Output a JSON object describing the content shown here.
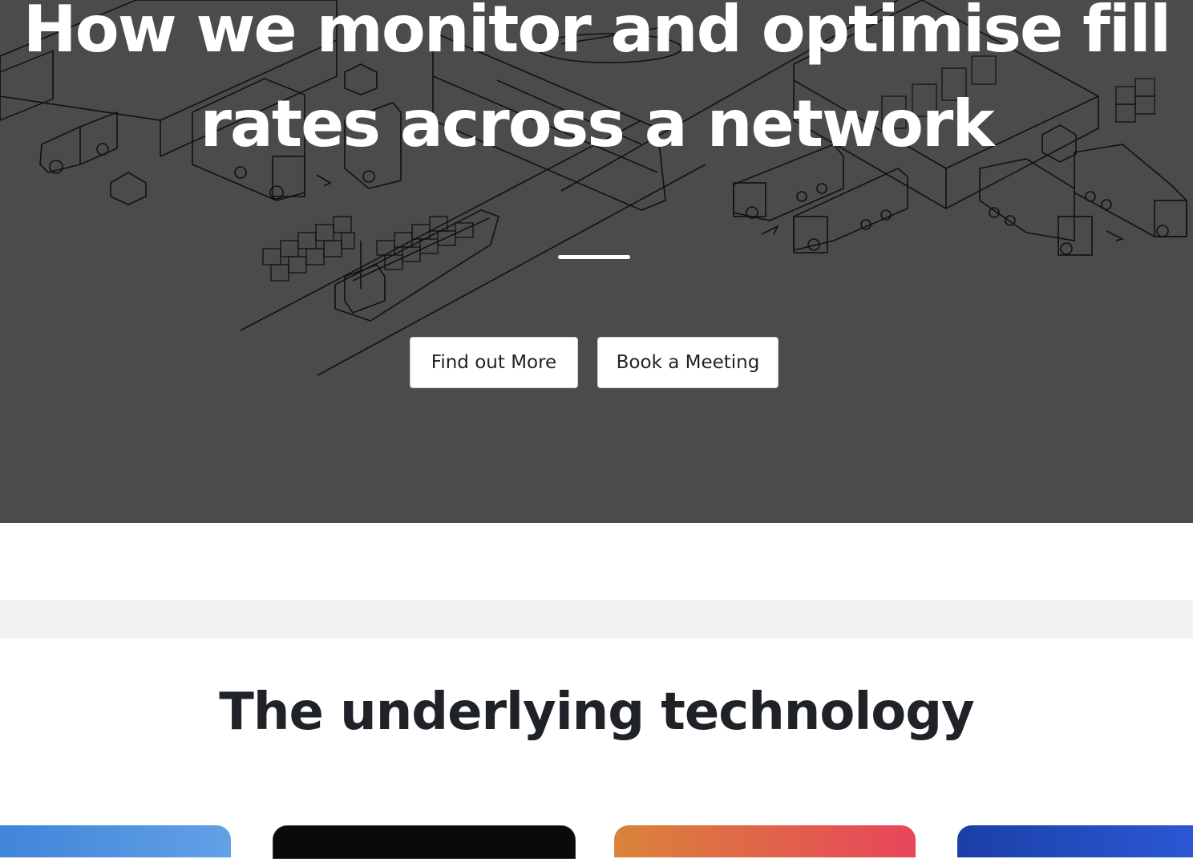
{
  "hero": {
    "title": "How we monitor and optimise fill rates across a network",
    "buttons": {
      "find_out_more": "Find out More",
      "book_meeting": "Book a Meeting"
    }
  },
  "technology": {
    "title": "The underlying technology"
  },
  "colors": {
    "hero_background": "#4b4b4b",
    "button_background": "#ffffff",
    "band": "#f2f2f5",
    "heading_dark": "#1f2227",
    "card_1": "#4a8de0",
    "card_2": "#0a0a0a",
    "card_3": "#e0604c",
    "card_4": "#2249bd"
  }
}
